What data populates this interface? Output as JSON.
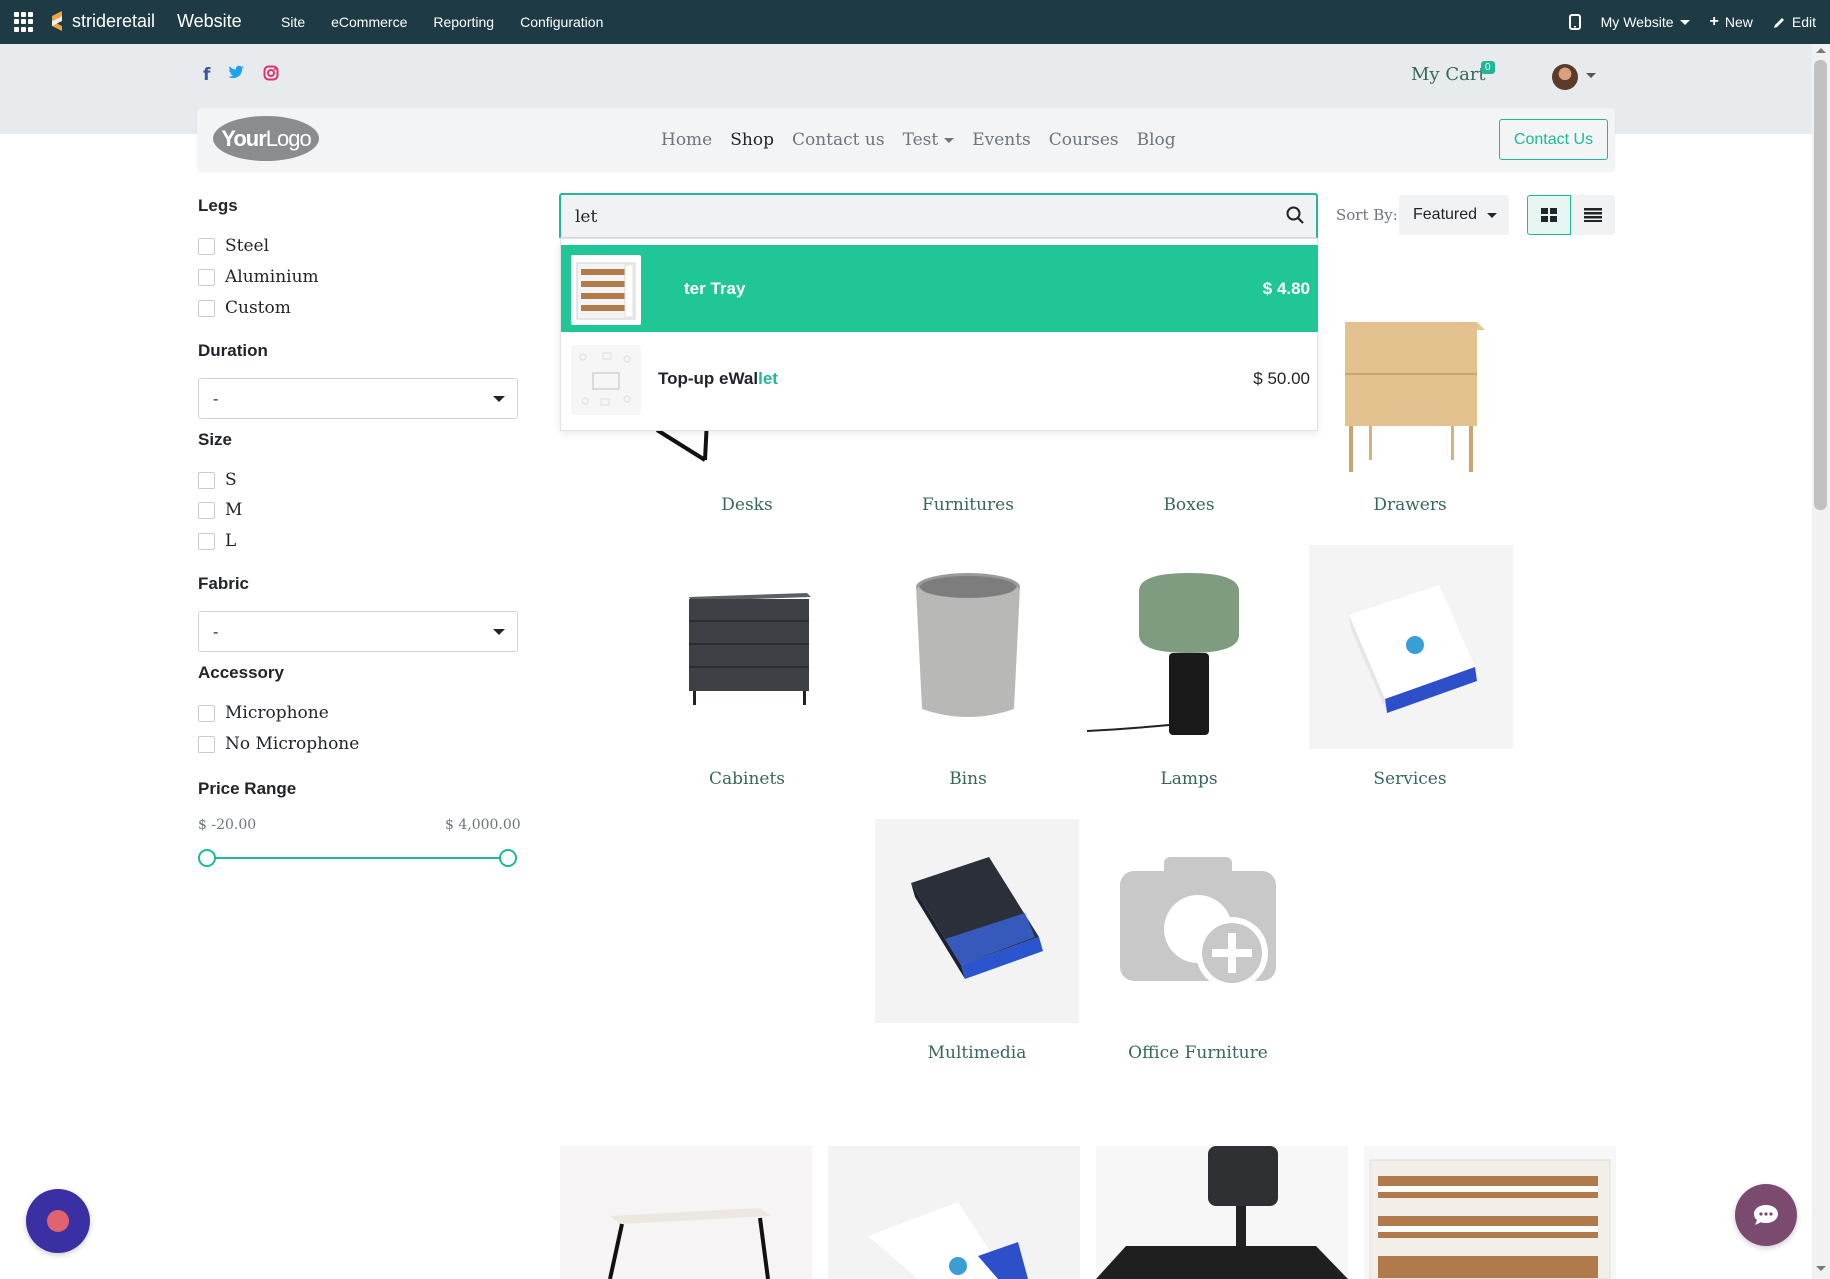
{
  "admin_bar": {
    "brand": "strideretail",
    "app_title": "Website",
    "menu": [
      "Site",
      "eCommerce",
      "Reporting",
      "Configuration"
    ],
    "website_selector": "My Website",
    "new_label": "New",
    "edit_label": "Edit"
  },
  "header": {
    "cart_label": "My Cart",
    "cart_count": "0",
    "social_icons": [
      "facebook-icon",
      "twitter-icon",
      "instagram-icon"
    ]
  },
  "navbar": {
    "logo_text_bold": "Your",
    "logo_text_light": "Logo",
    "links": [
      "Home",
      "Shop",
      "Contact us",
      "Test",
      "Events",
      "Courses",
      "Blog"
    ],
    "active_link": "Shop",
    "contact_button": "Contact Us"
  },
  "filters": {
    "legs": {
      "title": "Legs",
      "options": [
        "Steel",
        "Aluminium",
        "Custom"
      ]
    },
    "duration": {
      "title": "Duration",
      "selected": "-"
    },
    "size": {
      "title": "Size",
      "options": [
        "S",
        "M",
        "L"
      ]
    },
    "fabric": {
      "title": "Fabric",
      "selected": "-"
    },
    "accessory": {
      "title": "Accessory",
      "options": [
        "Microphone",
        "No Microphone"
      ]
    },
    "price_range": {
      "title": "Price Range",
      "min": "$ -20.00",
      "max": "$ 4,000.00"
    }
  },
  "search": {
    "value": "let",
    "sort_label": "Sort By:",
    "sort_value": "Featured"
  },
  "suggestions": [
    {
      "name": "ter Tray",
      "price": "$ 4.80"
    },
    {
      "name_pre": "Top-up eWal",
      "name_hl": "let",
      "price": "$ 50.00"
    }
  ],
  "categories": [
    "Desks",
    "Furnitures",
    "Boxes",
    "Drawers",
    "Cabinets",
    "Bins",
    "Lamps",
    "Services",
    "Multimedia",
    "Office Furniture"
  ],
  "colors": {
    "admin_bg": "#1e3b45",
    "accent": "#21b799",
    "highlight_row": "#21c696",
    "link": "#37675c"
  }
}
